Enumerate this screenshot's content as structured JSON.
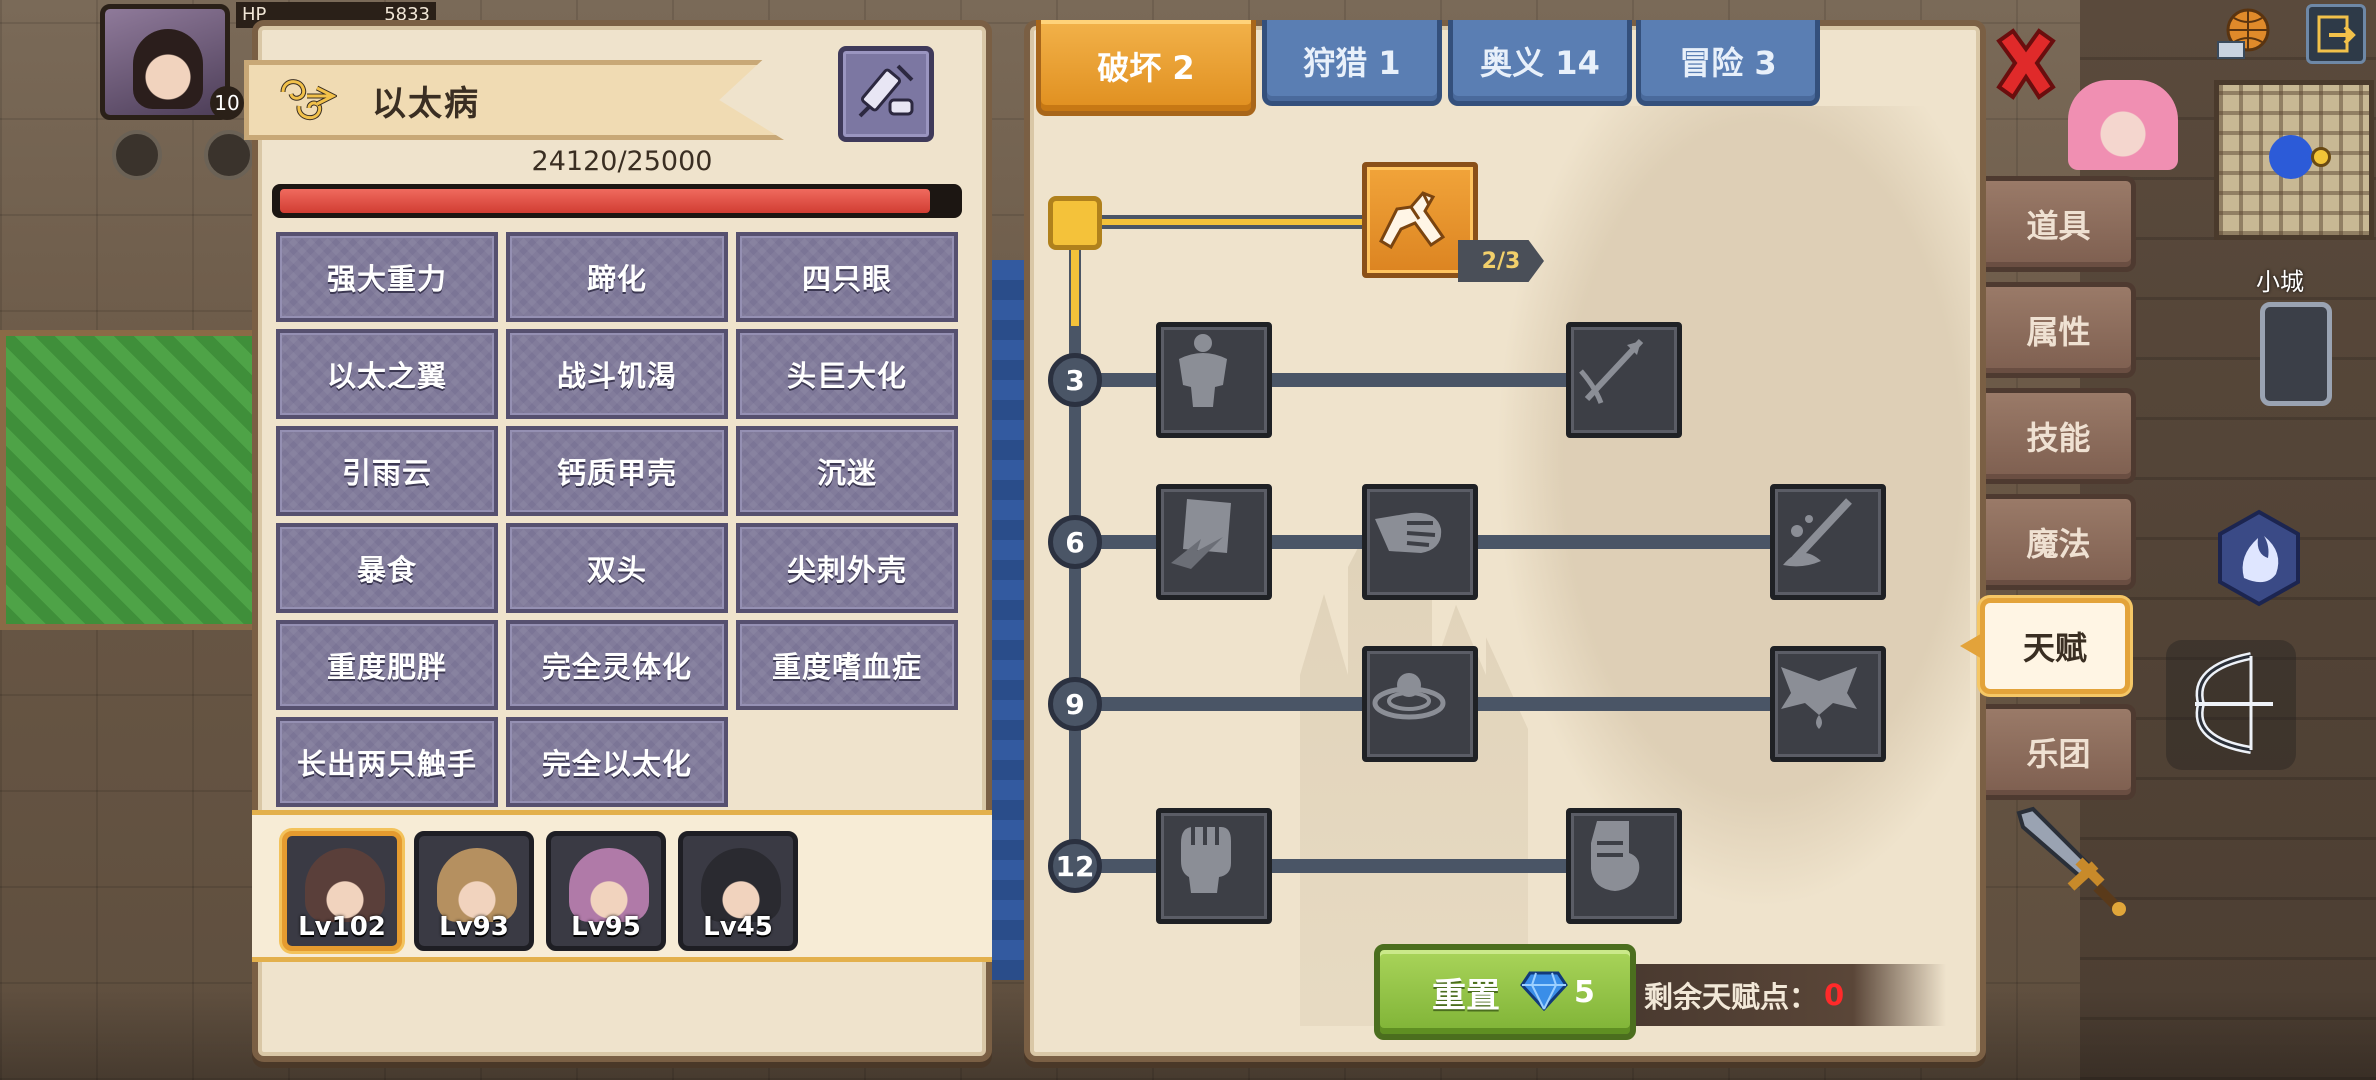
{
  "hud": {
    "hp_label": "HP",
    "hp_value": "5833",
    "player_level": "10"
  },
  "disease": {
    "name": "以太病",
    "progress_text": "24120/25000",
    "progress_fraction": 0.9648,
    "symptoms": [
      "强大重力",
      "蹄化",
      "四只眼",
      "以太之翼",
      "战斗饥渴",
      "头巨大化",
      "引雨云",
      "钙质甲壳",
      "沉迷",
      "暴食",
      "双头",
      "尖刺外壳",
      "重度肥胖",
      "完全灵体化",
      "重度嗜血症",
      "长出两只触手",
      "完全以太化"
    ]
  },
  "party": [
    {
      "level": "Lv102",
      "active": true,
      "hair": "#5a3f3a"
    },
    {
      "level": "Lv93",
      "active": false,
      "hair": "#b59060"
    },
    {
      "level": "Lv95",
      "active": false,
      "hair": "#b07aa8"
    },
    {
      "level": "Lv45",
      "active": false,
      "hair": "#2a2a30"
    }
  ],
  "tabs": [
    {
      "label": "破坏 2",
      "active": true
    },
    {
      "label": "狩猎 1",
      "active": false
    },
    {
      "label": "奥义 14",
      "active": false
    },
    {
      "label": "冒险 3",
      "active": false
    }
  ],
  "talent_tree": {
    "top_node_count": "2/3",
    "tiers": [
      "3",
      "6",
      "9",
      "12"
    ],
    "nodes": [
      {
        "name": "arm-wrestle",
        "icon": "arm-wrestle-icon",
        "unlocked": true
      },
      {
        "name": "muscle-body",
        "icon": "muscle-body-icon",
        "unlocked": false
      },
      {
        "name": "arrow-hit",
        "icon": "arrow-hit-icon",
        "unlocked": false
      },
      {
        "name": "shield-strike",
        "icon": "shield-strike-icon",
        "unlocked": false
      },
      {
        "name": "punch",
        "icon": "punch-icon",
        "unlocked": false
      },
      {
        "name": "blade-splash",
        "icon": "blade-splash-icon",
        "unlocked": false
      },
      {
        "name": "ripple",
        "icon": "ripple-icon",
        "unlocked": false
      },
      {
        "name": "demon-wings",
        "icon": "demon-wings-icon",
        "unlocked": false
      },
      {
        "name": "raised-fist",
        "icon": "raised-fist-icon",
        "unlocked": false
      },
      {
        "name": "clenched-fist",
        "icon": "clenched-fist-icon",
        "unlocked": false
      }
    ]
  },
  "reset": {
    "label": "重置",
    "cost": "5"
  },
  "remaining_points": {
    "label": "剩余天赋点：",
    "value": "0"
  },
  "side_menu": [
    {
      "label": "道具",
      "active": false
    },
    {
      "label": "属性",
      "active": false
    },
    {
      "label": "技能",
      "active": false
    },
    {
      "label": "魔法",
      "active": false
    },
    {
      "label": "天赋",
      "active": true
    },
    {
      "label": "乐团",
      "active": false
    }
  ],
  "minimap_label": "小城",
  "colors": {
    "accent_orange": "#e59b2f",
    "tab_blue": "#5a7eb3",
    "symptom_purple": "#7b7596",
    "progress_red": "#d13d33",
    "reset_green": "#7fb336",
    "points_red": "#ff2a2a"
  }
}
